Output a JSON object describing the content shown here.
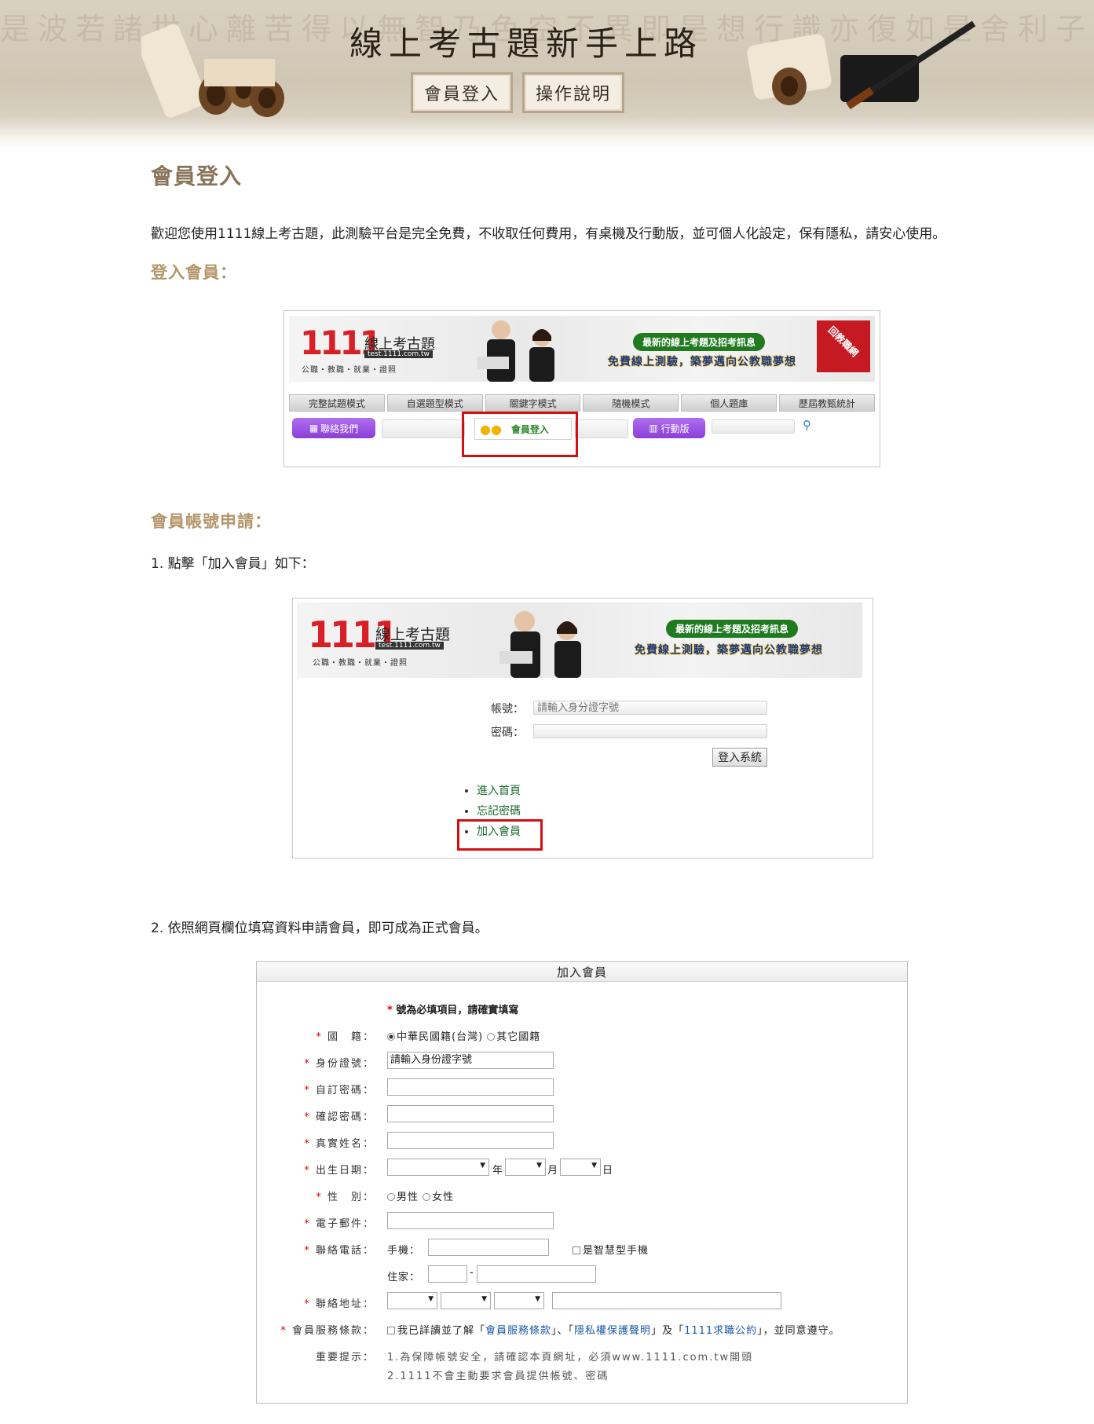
{
  "banner": {
    "title": "線上考古題新手上路",
    "login_button": "會員登入",
    "manual_button": "操作說明",
    "background_text": "是波若諸世心離苦得以無智乃色空不異即是想行識亦復如是舍利子諸法空相不生不滅是故空中無色無受想行識無眼耳鼻舌身意"
  },
  "page": {
    "heading": "會員登入",
    "intro": "歡迎您使用1111線上考古題，此測驗平台是完全免費，不收取任何費用，有桌機及行動版，並可個人化設定，保有隱私，請安心使用。",
    "section_login": "登入會員：",
    "section_apply": "會員帳號申請：",
    "step1": "1.   點擊「加入會員」如下：",
    "step2": "2.   依照網頁欄位填寫資料申請會員，即可成為正式會員。"
  },
  "brand": {
    "logo_number": "1111",
    "logo_name": "線上考古題",
    "logo_url": "test.1111.com.tw",
    "logo_sub": "公職・教職・就業・證照",
    "news_pill": "最新的線上考題及招考訊息",
    "slogan": "免費線上測驗，築夢邁向公教職夢想",
    "ribbon": "回教職網"
  },
  "shot1": {
    "tabs": [
      "完整試題模式",
      "自選題型模式",
      "關鍵字模式",
      "隨機模式",
      "個人題庫",
      "歷屆教甄統計"
    ],
    "contact_btn": "聯絡我們",
    "member_login": "會員登入",
    "mobile_btn": "行動版",
    "search_icon": "search-icon"
  },
  "shot2": {
    "account_label": "帳號：",
    "account_placeholder": "請輸入身分證字號",
    "password_label": "密碼：",
    "login_btn": "登入系統",
    "links": [
      "進入首頁",
      "忘記密碼",
      "加入會員"
    ]
  },
  "form": {
    "title": "加入會員",
    "required_note": "號為必填項目，請確實填寫",
    "star": "*",
    "labels": {
      "nationality": "國　籍：",
      "id": "身份證號：",
      "password": "自訂密碼：",
      "confirm": "確認密碼：",
      "name": "真實姓名：",
      "birthday": "出生日期：",
      "gender": "性　別：",
      "email": "電子郵件：",
      "phone": "聯絡電話：",
      "address": "聯絡地址：",
      "terms": "會員服務條款：",
      "notice": "重要提示："
    },
    "nationality_options": [
      "中華民國籍(台灣)",
      "其它國籍"
    ],
    "id_value": "請輸入身份證字號",
    "year": "年",
    "month": "月",
    "day": "日",
    "gender_options": [
      "男性",
      "女性"
    ],
    "mobile_label": "手機：",
    "smartphone": "是智慧型手機",
    "home_label": "住家：",
    "dash": "-",
    "terms_prefix": "我已詳讀並了解「",
    "terms_link1": "會員服務條款",
    "terms_mid1": "」、「",
    "terms_link2": "隱私權保護聲明",
    "terms_mid2": "」及「",
    "terms_link3": "1111求職公約",
    "terms_suffix": "」，並同意遵守。",
    "notice1": "1.為保障帳號安全，請確認本頁網址，必須www.1111.com.tw開頭",
    "notice2": "2.1111不會主動要求會員提供帳號、密碼"
  },
  "colors": {
    "heading": "#8a7459",
    "section": "#b3956b",
    "highlight_box": "#d40f14",
    "purple": "#8a3fd8",
    "green": "#1f7a20"
  }
}
